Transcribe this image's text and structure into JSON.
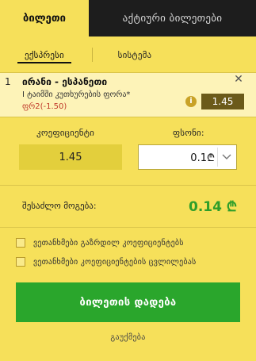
{
  "tabs": {
    "bet_slip": "ბილეთი",
    "active_bets": "აქტიური ბილეთები"
  },
  "sub_tabs": {
    "express": "ექსპრესი",
    "system": "სისტემა"
  },
  "bet": {
    "number": "1",
    "match": "ირანი - ესპანეთი",
    "market": "I ტაიმში კუთხურების ფორა*",
    "selection": "ფრ2(-1.50)",
    "odds": "1.45"
  },
  "form": {
    "coef_label": "კოეფიციენტი",
    "coef_value": "1.45",
    "stake_label": "ფსონი:",
    "stake_value": "0.1₾"
  },
  "winnings": {
    "label": "შესაძლო მოგება:",
    "value": "0.14 ₾"
  },
  "options": [
    "ვეთანხმები გაზრდილ კოეფიციენტებს",
    "ვეთანხმები კოეფიციენტების ცვლილებას"
  ],
  "actions": {
    "place_bet": "ბილეთის დადება",
    "cancel": "გაუქმება"
  },
  "colors": {
    "accent": "#f6e05a",
    "dark": "#1d1d1d",
    "win": "#2e9e2a",
    "button": "#2aa62c",
    "selection": "#c0392b"
  }
}
